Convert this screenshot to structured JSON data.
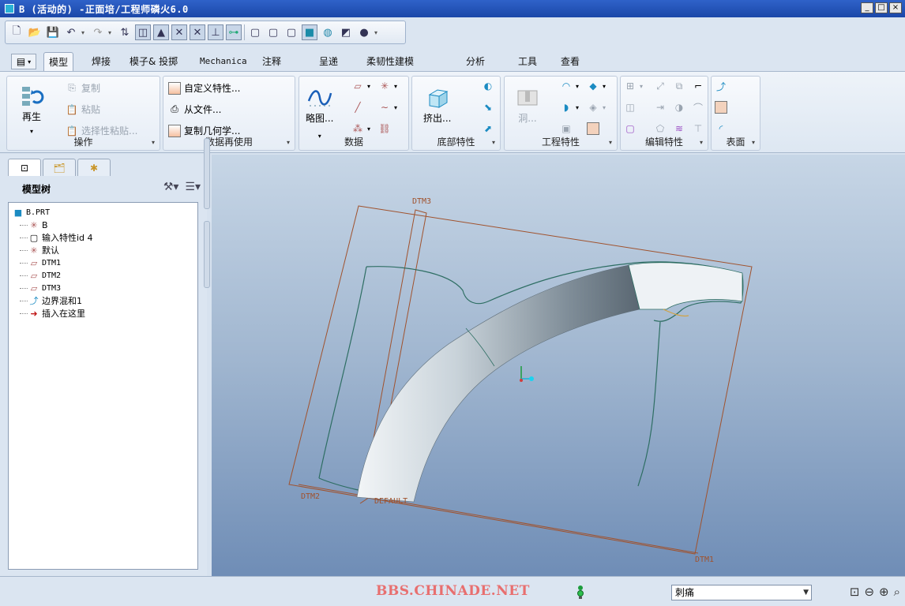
{
  "window": {
    "title": "B (活动的) -正面培/工程师磷火6.0",
    "buttons": [
      "_",
      "□",
      "×"
    ]
  },
  "quick_access": {
    "icons": [
      "new-icon",
      "open-icon",
      "save-icon",
      "undo-icon",
      "redo-icon",
      "regenerate-icon",
      "layer-icon",
      "display-icon",
      "datum-icon",
      "hidden-icon",
      "axis-icon",
      "csys-icon",
      "wireframe-icon",
      "hidden-line-icon",
      "no-hidden-icon",
      "shading-icon",
      "shade-edges-icon",
      "saved-view-icon",
      "render-icon"
    ]
  },
  "tabs": [
    "模型",
    "焊接",
    "模子& 投掷",
    "Mechanica",
    "注释",
    "呈递",
    "柔韧性建模",
    "分析",
    "工具",
    "查看"
  ],
  "ribbon": {
    "operations": {
      "label": "操作",
      "regen_label": "再生",
      "copy": "复制",
      "paste": "粘贴",
      "paste_special": "选择性粘贴..."
    },
    "data_reuse": {
      "label": "数据再使用",
      "items": [
        "自定义特性...",
        "从文件...",
        "复制几何学..."
      ]
    },
    "data": {
      "label": "数据",
      "sketch": "略图..."
    },
    "base_features": {
      "label": "底部特性",
      "extrude": "挤出..."
    },
    "engineering": {
      "label": "工程特性",
      "hole": "洞..."
    },
    "edit": {
      "label": "编辑特性"
    },
    "surfaces": {
      "label": "表面"
    }
  },
  "model_tree": {
    "header": "模型树",
    "root": "B.PRT",
    "items": [
      {
        "label": "B",
        "icon": "csys-icon"
      },
      {
        "label": "输入特性id 4",
        "icon": "import-feature-icon"
      },
      {
        "label": "默认",
        "icon": "csys-icon"
      },
      {
        "label": "DTM1",
        "icon": "datum-plane-icon"
      },
      {
        "label": "DTM2",
        "icon": "datum-plane-icon"
      },
      {
        "label": "DTM3",
        "icon": "datum-plane-icon"
      },
      {
        "label": "边界混和1",
        "icon": "boundary-blend-icon"
      },
      {
        "label": "插入在这里",
        "icon": "insert-arrow-icon"
      }
    ]
  },
  "viewport": {
    "labels": {
      "dtm3": "DTM3",
      "dtm2": "DTM2",
      "dtm1": "DTM1",
      "default": "DEFAULT"
    }
  },
  "status": {
    "watermark": "BBS.CHINADE.NET",
    "filter_value": "刺痛"
  },
  "colors": {
    "datum_line": "#a0522d",
    "surface_edge": "#2e6e63",
    "title_bar": "#1b47a8",
    "viewport_top": "#c7d6e6",
    "viewport_bottom": "#6f8db6",
    "watermark": "#e86f6f"
  }
}
